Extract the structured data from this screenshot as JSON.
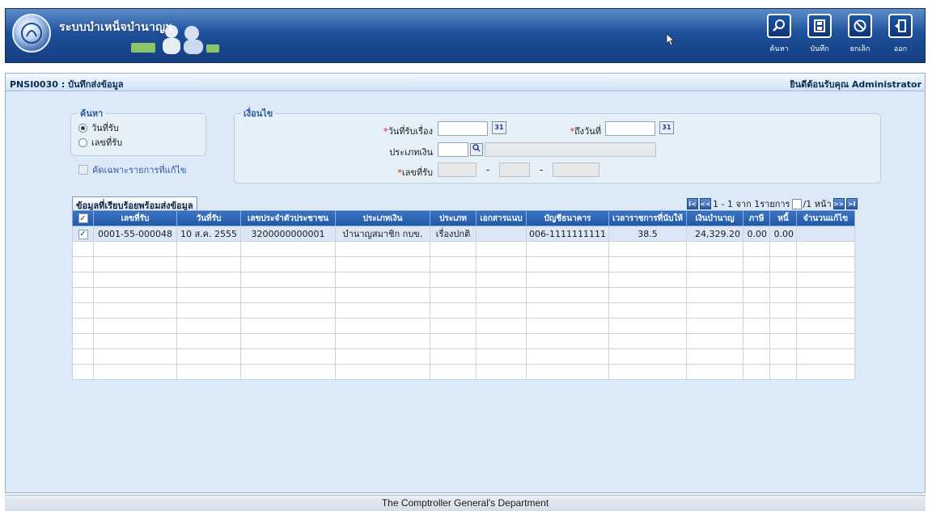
{
  "header": {
    "app_title": "ระบบบำเหน็จบำนาญฯ",
    "toolbar": [
      {
        "label": "ค้นหา",
        "icon": "search-icon"
      },
      {
        "label": "บันทึก",
        "icon": "save-icon"
      },
      {
        "label": "ยกเลิก",
        "icon": "cancel-icon"
      },
      {
        "label": "ออก",
        "icon": "exit-icon"
      }
    ]
  },
  "page": {
    "code_title": "PNSI0030 : บันทึกส่งข้อมูล",
    "welcome": "ยินดีต้อนรับคุณ Administrator"
  },
  "search_group": {
    "legend": "ค้นหา",
    "options": [
      "วันที่รับ",
      "เลขที่รับ"
    ],
    "selected_index": 0,
    "edited_only_label": "คัดเฉพาะรายการที่แก้ไข"
  },
  "condition_group": {
    "legend": "เงื่อนไข",
    "received_date_label": "วันที่รับเรื่อง",
    "to_date_label": "ถึงวันที่",
    "money_type_label": "ประเภทเงิน",
    "receipt_no_label": "เลขที่รับ",
    "received_date_value": "",
    "to_date_value": "",
    "money_type_code": "",
    "money_type_name": "",
    "receipt_no_parts": [
      "",
      "",
      ""
    ],
    "cal_icon_text": "31",
    "dash": "-"
  },
  "grid": {
    "tab_label": "ข้อมูลที่เรียบร้อยพร้อมส่งข้อมูล",
    "pager": {
      "first": "I<",
      "prev": "<<",
      "summary": "1 - 1 จาก 1รายการ",
      "page": "1",
      "page_total": "/1 หน้า",
      "next": ">>",
      "last": ">I"
    },
    "columns": [
      "เลขที่รับ",
      "วันที่รับ",
      "เลขประจำตัวประชาชน",
      "ประเภทเงิน",
      "ประเภท",
      "เอกสารแนบ",
      "บัญชีธนาคาร",
      "เวลาราชการที่นับให้",
      "เงินบำนาญ",
      "ภาษี",
      "หนี้",
      "จำนวนแก้ไข"
    ],
    "rows": [
      {
        "checked": true,
        "receipt_no": "0001-55-000048",
        "date": "10 ส.ค. 2555",
        "citizen_id": "3200000000001",
        "money_type": "บำนาญสมาชิก กบข.",
        "type": "เรื่องปกติ",
        "attachment": "",
        "bank_account": "006-1111111111",
        "service_time": "38.5",
        "pension": "24,329.20",
        "tax": "0.00",
        "debt": "0.00",
        "edit_count": ""
      }
    ],
    "empty_rows": 9
  },
  "footer": {
    "text": "The Comptroller General's Department"
  }
}
